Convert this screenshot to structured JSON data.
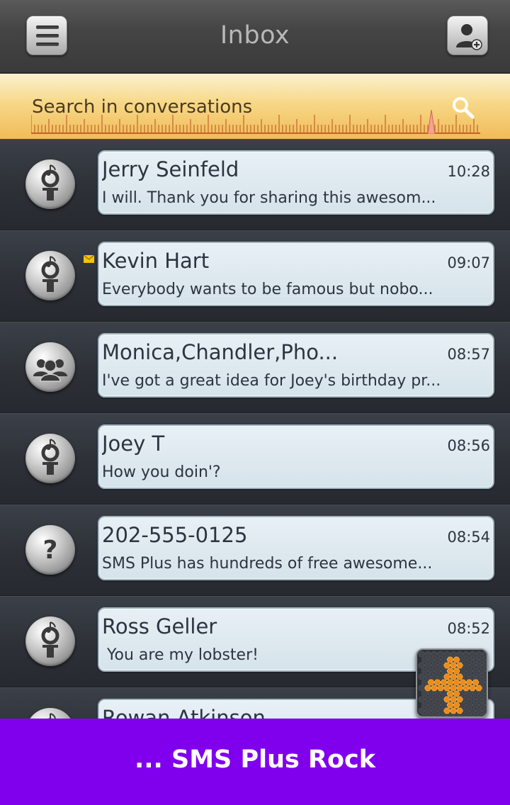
{
  "header": {
    "title": "Inbox",
    "menu_icon": "hamburger-menu-icon",
    "contact_icon": "add-contact-icon"
  },
  "search": {
    "placeholder": "Search in conversations",
    "icon": "search-icon"
  },
  "conversations": [
    {
      "name": "Jerry Seinfeld",
      "time": "10:28",
      "preview": "I will. Thank you for sharing this awesom...",
      "avatar": "person-icon",
      "unread": false
    },
    {
      "name": "Kevin Hart",
      "time": "09:07",
      "preview": "Everybody wants to be famous but nobo...",
      "avatar": "person-icon",
      "unread": true
    },
    {
      "name": "Monica,Chandler,Pho...",
      "time": "08:57",
      "preview": "I've got a great idea for Joey's birthday pr...",
      "avatar": "group-icon",
      "unread": false
    },
    {
      "name": "Joey T",
      "time": "08:56",
      "preview": "How you doin'?",
      "avatar": "person-icon",
      "unread": false
    },
    {
      "name": "202-555-0125",
      "time": "08:54",
      "preview": "SMS Plus has hundreds of free awesome...",
      "avatar": "unknown-contact-icon",
      "unread": false
    },
    {
      "name": "Ross Geller",
      "time": "08:52",
      "preview": " You are my lobster!",
      "avatar": "person-icon",
      "unread": false
    },
    {
      "name": "Rowan Atkinson",
      "time": "",
      "preview": "",
      "avatar": "person-icon",
      "unread": false
    }
  ],
  "fab": {
    "icon": "plus-icon"
  },
  "banner": {
    "text": "... SMS Plus Rock"
  },
  "colors": {
    "banner": "#8000ee",
    "search_bar": "#f7d887",
    "fab_plus": "#f08a16",
    "unread_envelope": "#f5c400"
  }
}
